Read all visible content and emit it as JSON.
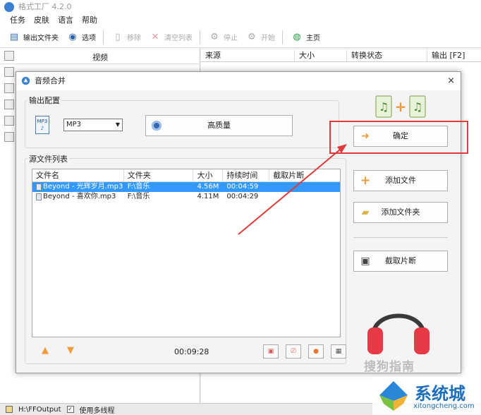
{
  "app": {
    "title": "格式工厂 4.2.0",
    "menu": [
      "任务",
      "皮肤",
      "语言",
      "帮助"
    ],
    "toolbar": [
      {
        "label": "输出文件夹",
        "icon": "folder-icon",
        "enabled": true
      },
      {
        "label": "选项",
        "icon": "options-icon",
        "enabled": true
      },
      {
        "label": "移除",
        "icon": "remove-icon",
        "enabled": false
      },
      {
        "label": "清空列表",
        "icon": "clear-list-icon",
        "enabled": false
      },
      {
        "label": "停止",
        "icon": "stop-icon",
        "enabled": false
      },
      {
        "label": "开始",
        "icon": "start-icon",
        "enabled": false
      },
      {
        "label": "主页",
        "icon": "home-icon",
        "enabled": true
      }
    ],
    "left_category": "视频",
    "grid_columns": [
      "来源",
      "大小",
      "转换状态",
      "输出 [F2]"
    ],
    "status": {
      "output_path": "H:\\FFOutput",
      "multithread_label": "使用多线程",
      "multithread_checked": true
    }
  },
  "dialog": {
    "title": "音频合并",
    "output_group": "输出配置",
    "format_icon_text": "MP3",
    "format_selected": "MP3",
    "quality_label": "高质量",
    "source_group": "源文件列表",
    "table": {
      "columns": [
        "文件名",
        "文件夹",
        "大小",
        "持续时间",
        "截取片断"
      ],
      "rows": [
        {
          "name": "Beyond - 光辉岁月.mp3",
          "folder": "F:\\音乐",
          "size": "4.56M",
          "duration": "00:04:59",
          "clip": "",
          "selected": true
        },
        {
          "name": "Beyond - 喜欢你.mp3",
          "folder": "F:\\音乐",
          "size": "4.11M",
          "duration": "00:04:29",
          "clip": "",
          "selected": false
        }
      ]
    },
    "total_duration": "00:09:28",
    "buttons": {
      "confirm": "确定",
      "add_file": "添加文件",
      "add_folder": "添加文件夹",
      "clip": "截取片断"
    },
    "close_glyph": "×"
  },
  "watermarks": {
    "sogou": "搜狗指南",
    "brand_name": "系统城",
    "brand_url": "xitongcheng.com"
  },
  "colors": {
    "highlight": "#e03a3a",
    "selection": "#3399ff",
    "headphone_red": "#e63b45",
    "headphone_dark": "#3a3a3a",
    "accent_orange": "#f09a3a"
  }
}
